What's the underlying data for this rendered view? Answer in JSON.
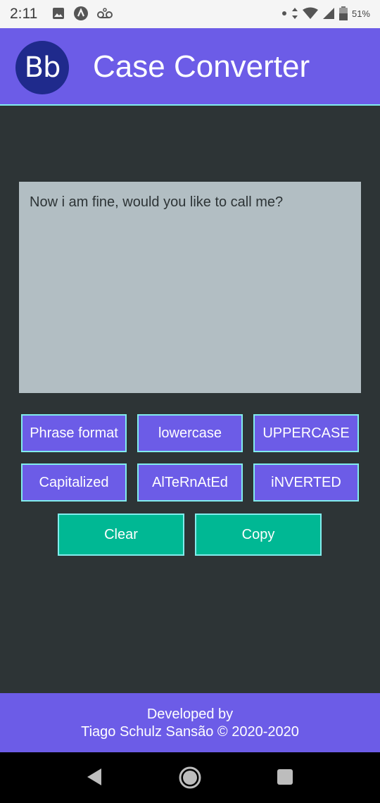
{
  "status_bar": {
    "time": "2:11",
    "battery": "51%"
  },
  "app_bar": {
    "logo_text": "Bb",
    "title": "Case Converter"
  },
  "editor": {
    "value": "Now i am fine, would you like to call me?"
  },
  "case_buttons": {
    "phrase": "Phrase format",
    "lower": "lowercase",
    "upper": "UPPERCASE",
    "capitalized": "Capitalized",
    "alternated": "AlTeRnAtEd",
    "inverted": "iNVERTED"
  },
  "actions": {
    "clear": "Clear",
    "copy": "Copy"
  },
  "footer": {
    "line1": "Developed by",
    "line2": "Tiago Schulz Sansão © 2020-2020"
  },
  "colors": {
    "primary": "#6c5ce7",
    "accent_border": "#81ecec",
    "action": "#00b894",
    "background": "#2d3436",
    "editor_bg": "#b2bec3"
  }
}
